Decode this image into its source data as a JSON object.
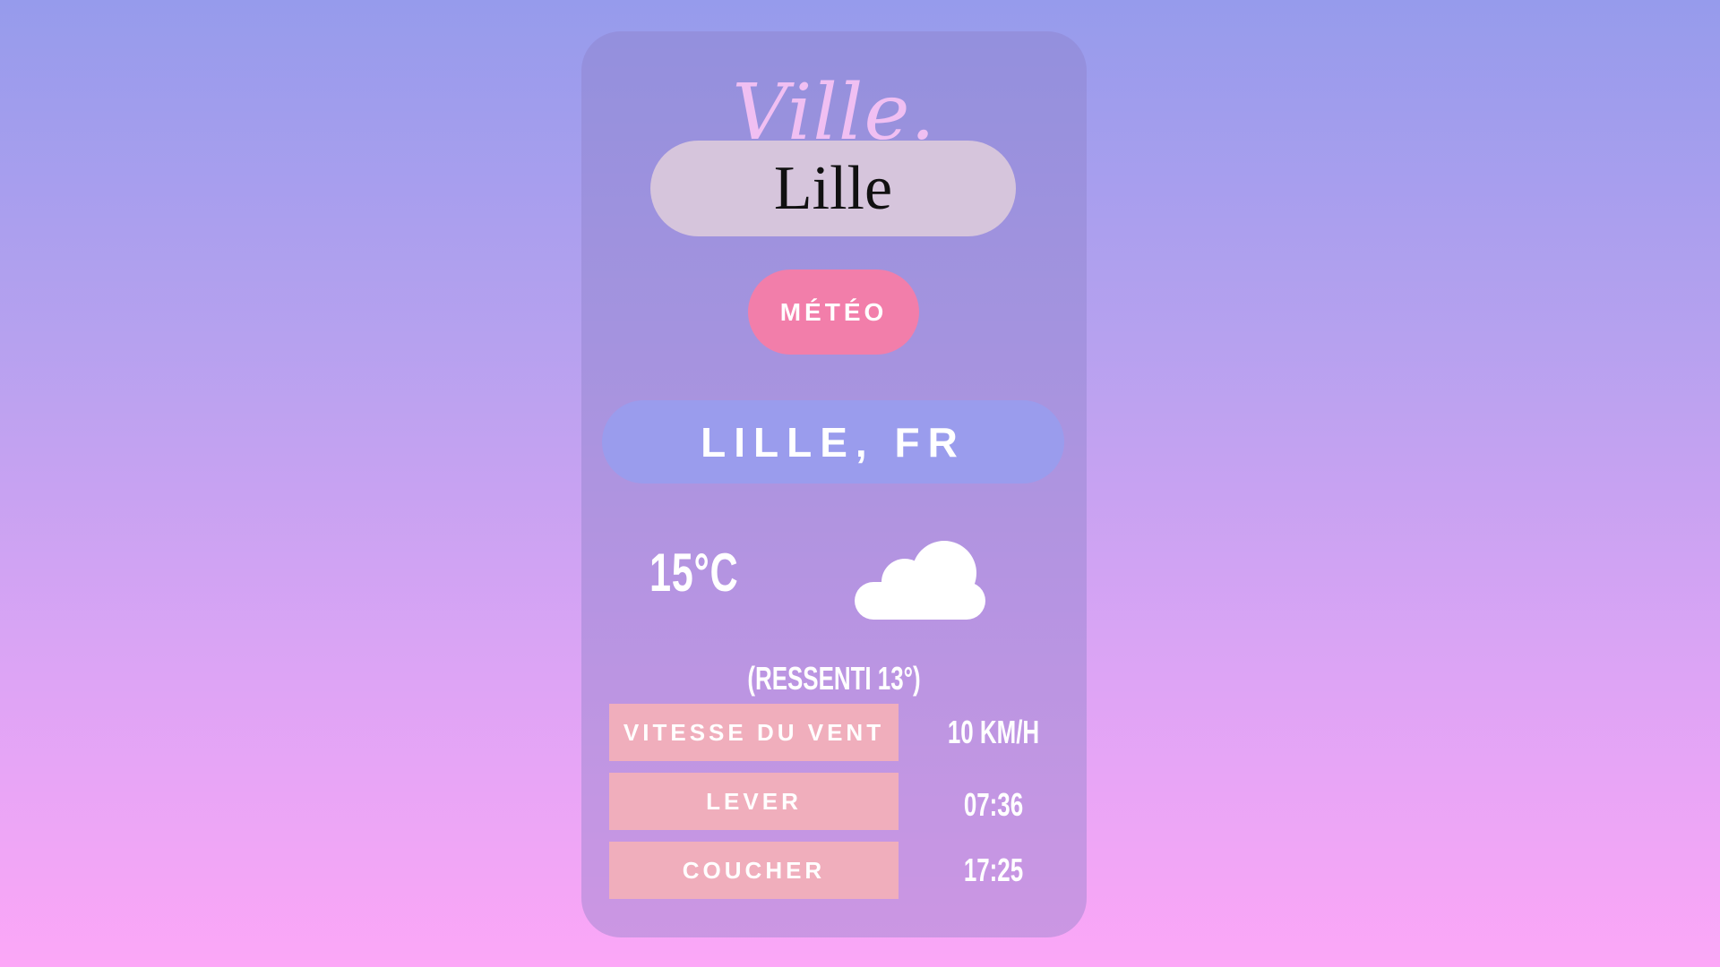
{
  "brand": {
    "title": "Ville."
  },
  "search": {
    "value": "Lille"
  },
  "actions": {
    "meteo_label": "MÉTÉO"
  },
  "weather": {
    "location": "LILLE, FR",
    "temperature": "15°C",
    "condition_icon": "cloud-icon",
    "feels_like": "(RESSENTI 13°)"
  },
  "details": [
    {
      "label": "VITESSE DU VENT",
      "value": "10 KM/H"
    },
    {
      "label": "LEVER",
      "value": "07:36"
    },
    {
      "label": "COUCHER",
      "value": "17:25"
    }
  ],
  "colors": {
    "accent_pink": "#f27eaa",
    "location_pill": "#9a9ced",
    "detail_label_bg": "#f0aebc",
    "input_bg": "#d6c5dc",
    "brand_text": "#f0bff2"
  }
}
